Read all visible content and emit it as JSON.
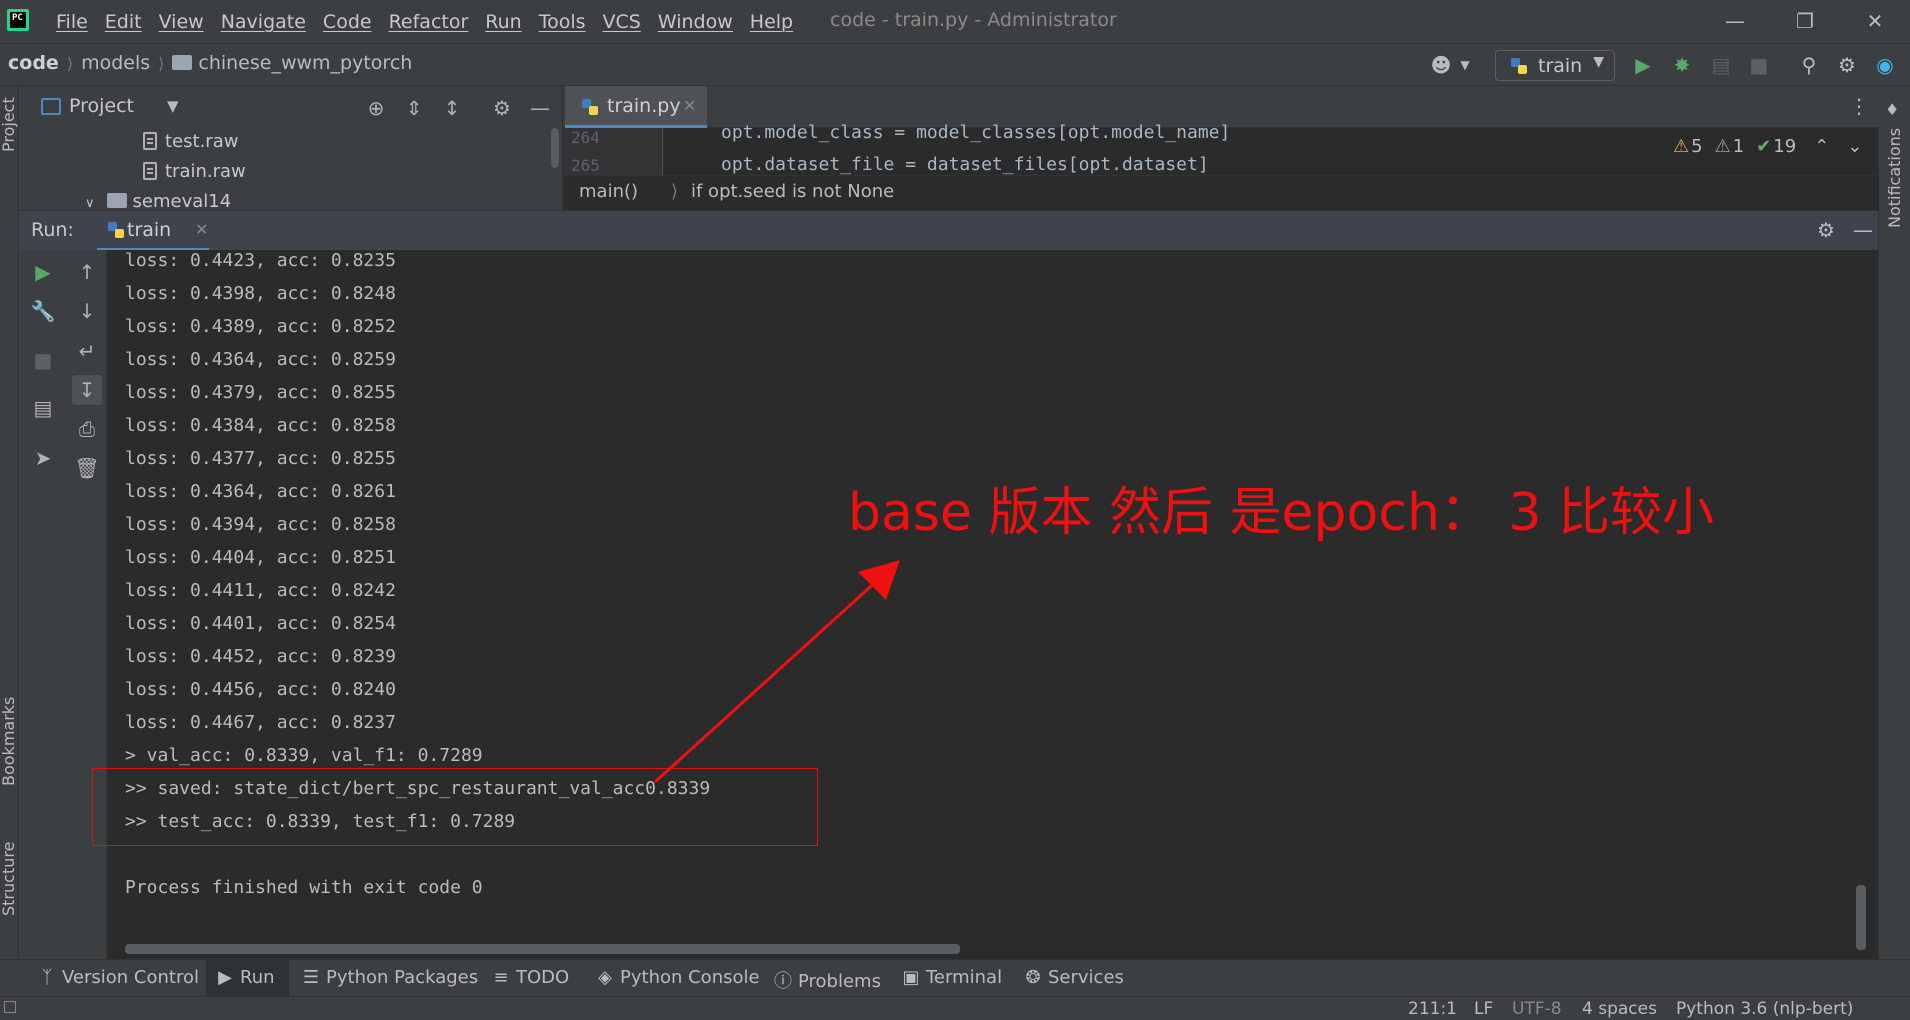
{
  "titlebar": {
    "menu": [
      "File",
      "Edit",
      "View",
      "Navigate",
      "Code",
      "Refactor",
      "Run",
      "Tools",
      "VCS",
      "Window",
      "Help"
    ],
    "window_title": "code - train.py - Administrator",
    "logo_text": "PC"
  },
  "navbar": {
    "crumbs": [
      "code",
      "models",
      "chinese_wwm_pytorch"
    ],
    "run_config": "train"
  },
  "left_stripe": {
    "project": "Project",
    "bookmarks": "Bookmarks",
    "structure": "Structure"
  },
  "right_stripe": {
    "notifications": "Notifications"
  },
  "project_panel": {
    "title": "Project",
    "tree": [
      "test.raw",
      "train.raw",
      "semeval14"
    ]
  },
  "editor": {
    "tab": "train.py",
    "lines": [
      {
        "num": "264",
        "code": "opt.model_class = model_classes[opt.model_name]"
      },
      {
        "num": "265",
        "code": "opt.dataset_file = dataset_files[opt.dataset]"
      }
    ],
    "inspections": {
      "warnings": "5",
      "weak_warnings": "1",
      "ok": "19"
    },
    "breadcrumb": [
      "main()",
      "if opt.seed is not None"
    ]
  },
  "run_panel": {
    "label": "Run:",
    "tab": "train"
  },
  "console": {
    "lines": [
      "loss: 0.4423, acc: 0.8235",
      "loss: 0.4398, acc: 0.8248",
      "loss: 0.4389, acc: 0.8252",
      "loss: 0.4364, acc: 0.8259",
      "loss: 0.4379, acc: 0.8255",
      "loss: 0.4384, acc: 0.8258",
      "loss: 0.4377, acc: 0.8255",
      "loss: 0.4364, acc: 0.8261",
      "loss: 0.4394, acc: 0.8258",
      "loss: 0.4404, acc: 0.8251",
      "loss: 0.4411, acc: 0.8242",
      "loss: 0.4401, acc: 0.8254",
      "loss: 0.4452, acc: 0.8239",
      "loss: 0.4456, acc: 0.8240",
      "loss: 0.4467, acc: 0.8237",
      "> val_acc: 0.8339, val_f1: 0.7289",
      ">> saved: state_dict/bert_spc_restaurant_val_acc0.8339",
      ">> test_acc: 0.8339, test_f1: 0.7289",
      "",
      "Process finished with exit code 0"
    ]
  },
  "annotation": {
    "text": "base 版本 然后 是epoch： 3 比较小",
    "color": "#f01010"
  },
  "bottom_tabs": [
    {
      "label": "Version Control",
      "icon": "branch-icon"
    },
    {
      "label": "Run",
      "icon": "play-icon"
    },
    {
      "label": "Python Packages",
      "icon": "layers-icon"
    },
    {
      "label": "TODO",
      "icon": "list-icon"
    },
    {
      "label": "Python Console",
      "icon": "python-icon"
    },
    {
      "label": "Problems",
      "icon": "info-icon"
    },
    {
      "label": "Terminal",
      "icon": "terminal-icon"
    },
    {
      "label": "Services",
      "icon": "services-icon"
    }
  ],
  "status_bar": {
    "position": "211:1",
    "line_sep": "LF",
    "encoding": "UTF-8",
    "indent": "4 spaces",
    "interpreter": "Python 3.6 (nlp-bert)"
  }
}
